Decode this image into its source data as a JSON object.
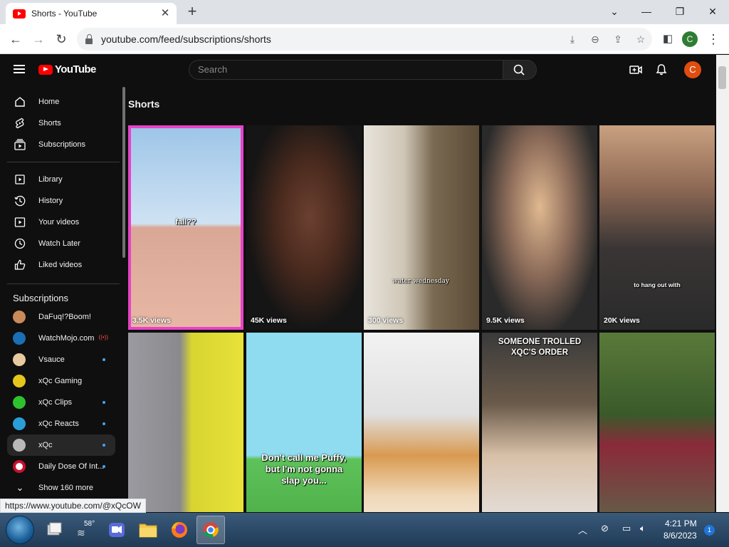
{
  "browser": {
    "tab_title": "Shorts - YouTube",
    "url": "youtube.com/feed/subscriptions/shorts",
    "profile_initial": "C",
    "status_url": "https://www.youtube.com/@xQcOW"
  },
  "header": {
    "logo_text": "YouTube",
    "search_placeholder": "Search",
    "avatar_initial": "C"
  },
  "sidebar": {
    "main": [
      {
        "label": "Home",
        "icon": "home-icon"
      },
      {
        "label": "Shorts",
        "icon": "shorts-icon"
      },
      {
        "label": "Subscriptions",
        "icon": "subscriptions-icon"
      }
    ],
    "library": [
      {
        "label": "Library",
        "icon": "library-icon"
      },
      {
        "label": "History",
        "icon": "history-icon"
      },
      {
        "label": "Your videos",
        "icon": "your-videos-icon"
      },
      {
        "label": "Watch Later",
        "icon": "watch-later-icon"
      },
      {
        "label": "Liked videos",
        "icon": "liked-videos-icon"
      }
    ],
    "subscriptions_header": "Subscriptions",
    "channels": [
      {
        "label": "DaFuq!?Boom!",
        "color": "#c98a5a"
      },
      {
        "label": "WatchMojo.com",
        "color": "#1a6fb5"
      },
      {
        "label": "Vsauce",
        "color": "#e8c9a0"
      },
      {
        "label": "xQc Gaming",
        "color": "#e6c61a"
      },
      {
        "label": "xQc Clips",
        "color": "#2ec22e"
      },
      {
        "label": "xQc Reacts",
        "color": "#2a9ed8"
      },
      {
        "label": "xQc",
        "color": "#b8b8b8"
      },
      {
        "label": "Daily Dose Of Int...",
        "color": "#c8102e"
      }
    ],
    "show_more": "Show 160 more"
  },
  "main": {
    "title": "Shorts",
    "shorts": [
      {
        "views": "3.5K views",
        "caption": "fall??"
      },
      {
        "views": "45K views",
        "caption": ""
      },
      {
        "views": "300 views",
        "caption": "water wednesday"
      },
      {
        "views": "9.5K views",
        "caption": ""
      },
      {
        "views": "20K views",
        "caption": "to hang out with"
      },
      {
        "views": "",
        "caption": ""
      },
      {
        "views": "",
        "caption": "Don't call me Puffy, but I'm not gonna slap you..."
      },
      {
        "views": "",
        "caption": ""
      },
      {
        "views": "",
        "caption": "SOMEONE TROLLED XQC'S ORDER"
      },
      {
        "views": "",
        "caption": ""
      }
    ]
  },
  "taskbar": {
    "weather": "58°",
    "time": "4:21 PM",
    "date": "8/6/2023",
    "notifications": "1"
  },
  "colors": {
    "yt_red": "#ff0000",
    "bg": "#0f0f0f",
    "accent_blue": "#3ea6ff"
  }
}
